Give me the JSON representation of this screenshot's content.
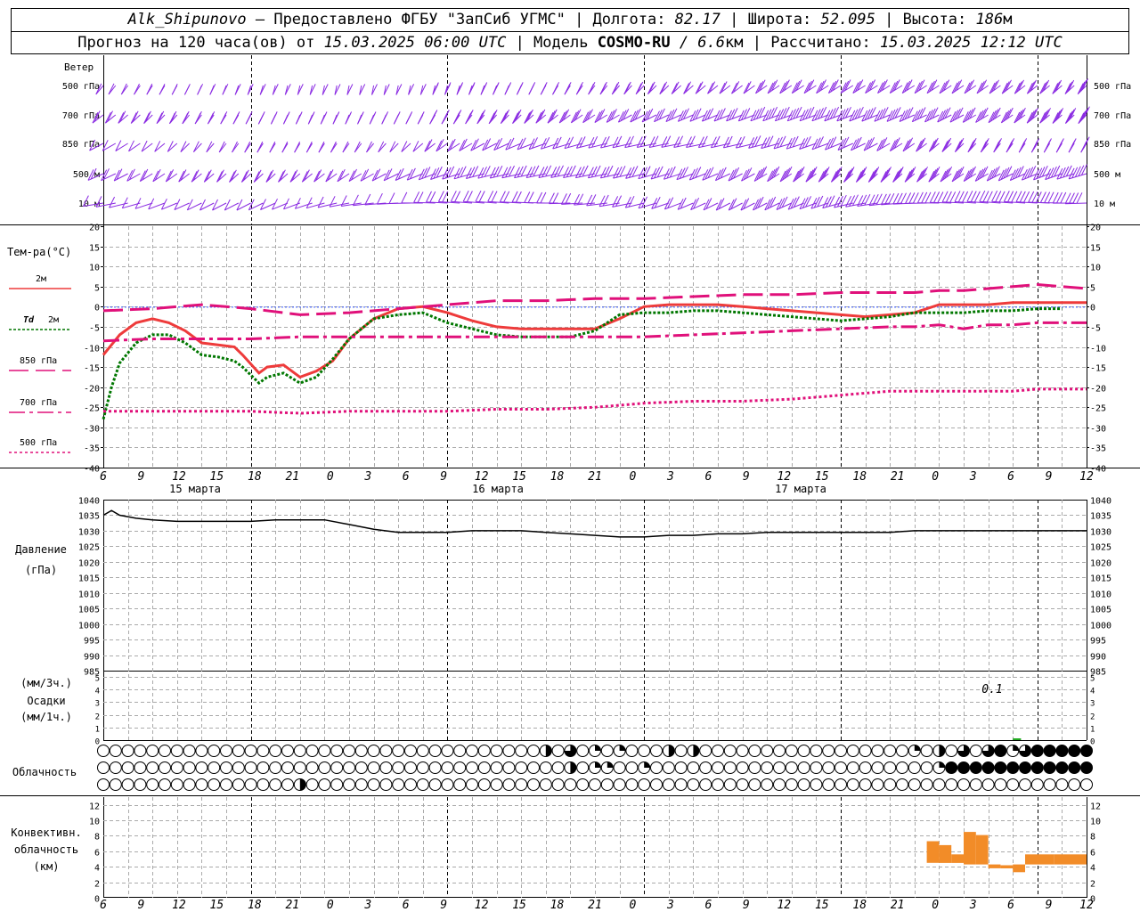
{
  "header": {
    "station": "Alk_Shipunovo",
    "provider": " – Предоставлено ФГБУ \"ЗапСиб УГМС\" | Долгота: ",
    "lon": "82.17",
    "lat_label": " | Широта: ",
    "lat": "52.095",
    "alt_label": " | Высота: ",
    "alt": "186",
    "alt_unit": "м",
    "forecast_prefix": "Прогноз на 120 часа(ов) от ",
    "forecast_time": "15.03.2025 06:00 UTC",
    "model_label": "  | Модель ",
    "model": "COSMO-RU",
    "model_res": " / 6.6",
    "model_unit": "км",
    "calc_label": " | Рассчитано: ",
    "calc_time": "15.03.2025 12:12 UTC"
  },
  "colors": {
    "grid": "#aaaaaa",
    "wind": "#8a2be2",
    "t2m": "#ee3b3b",
    "td2m": "#007700",
    "t850": "#e0107a",
    "t700": "#e0107a",
    "t500": "#e0107a",
    "pressure": "#000000",
    "convective": "#f28c28"
  },
  "labels": {
    "wind": "Ветер",
    "wind_levels": [
      "500 гПа",
      "700 гПа",
      "850 гПа",
      "500 м",
      "10 м"
    ],
    "temp": "Тем-ра(°C)",
    "legend_2m": "2м",
    "legend_td": "Td",
    "legend_td2": "2м",
    "legend_850": "850 гПа",
    "legend_700": "700 гПа",
    "legend_500": "500 гПа",
    "pressure1": "Давление",
    "pressure2": "(гПа)",
    "precip1": "(мм/3ч.)",
    "precip2": "Осадки",
    "precip3": "(мм/1ч.)",
    "cloud": "Облачность",
    "conv1": "Конвективн.",
    "conv2": "облачность",
    "conv3": "(км)",
    "precip_annotation": "0.1"
  },
  "chart_data": {
    "type": "line",
    "x_hours": [
      0,
      120
    ],
    "x_tick_labels": [
      "6",
      "9",
      "12",
      "15",
      "18",
      "21",
      "0",
      "3",
      "6",
      "9",
      "12",
      "15",
      "18",
      "21",
      "0",
      "3",
      "6",
      "9",
      "12",
      "15",
      "18",
      "21",
      "0",
      "3",
      "6",
      "9",
      "12"
    ],
    "date_labels": [
      "15 марта",
      "16 марта",
      "17 марта"
    ],
    "temperature": {
      "ylim": [
        -40,
        20
      ],
      "ticks": [
        -40,
        -35,
        -30,
        -25,
        -20,
        -15,
        -10,
        -5,
        0,
        5,
        10,
        15,
        20
      ],
      "series": [
        {
          "name": "2м",
          "key": "t2m",
          "x": [
            0,
            2,
            4,
            6,
            8,
            10,
            12,
            14,
            16,
            17,
            19,
            20,
            22,
            24,
            26,
            28,
            30,
            33,
            36,
            39,
            42,
            45,
            48,
            51,
            54,
            57,
            60,
            63,
            66,
            69,
            72,
            75,
            78,
            81,
            84,
            87,
            90,
            93,
            96,
            99,
            102,
            105,
            108,
            111,
            114,
            117,
            120
          ],
          "y": [
            -12,
            -7,
            -4,
            -3,
            -4,
            -6,
            -9,
            -9.5,
            -10,
            -12,
            -16.5,
            -15,
            -14.5,
            -17.5,
            -16,
            -13.5,
            -8,
            -3,
            -0.5,
            0,
            -1.5,
            -3.5,
            -5,
            -5.5,
            -5.5,
            -5.5,
            -5.5,
            -3,
            0,
            0.5,
            0.5,
            0.5,
            0,
            -0.5,
            -1,
            -1.5,
            -2,
            -2.5,
            -2,
            -1.5,
            0.5,
            0.5,
            0.5,
            1,
            1,
            1,
            1
          ]
        },
        {
          "name": "Td 2м",
          "key": "td2m",
          "x": [
            0,
            1,
            2,
            4,
            6,
            8,
            10,
            12,
            14,
            16,
            17,
            19,
            20,
            22,
            24,
            26,
            28,
            30,
            33,
            36,
            39,
            42,
            45,
            48,
            51,
            54,
            57,
            60,
            63,
            66,
            69,
            72,
            75,
            78,
            81,
            84,
            87,
            90,
            93,
            96,
            99,
            102,
            105,
            108,
            111,
            114,
            117,
            120
          ],
          "y": [
            -28,
            -20,
            -14,
            -9,
            -7,
            -7,
            -9,
            -12,
            -12.5,
            -13.5,
            -15,
            -19,
            -17.5,
            -16.5,
            -19,
            -17.5,
            -13,
            -8,
            -3,
            -2,
            -1.5,
            -4,
            -5.5,
            -7,
            -7.5,
            -7.5,
            -7.5,
            -6,
            -2,
            -1.5,
            -1.5,
            -1,
            -1,
            -1.5,
            -2,
            -2.5,
            -3,
            -3.5,
            -3,
            -2.5,
            -1.5,
            -1.5,
            -1.5,
            -1,
            -1,
            -0.5,
            -0.5
          ]
        },
        {
          "name": "850 гПа",
          "key": "t850",
          "x": [
            0,
            6,
            12,
            18,
            24,
            30,
            36,
            42,
            48,
            54,
            60,
            66,
            72,
            78,
            84,
            90,
            96,
            99,
            102,
            105,
            108,
            111,
            114,
            117,
            120
          ],
          "y": [
            -1,
            -0.5,
            0.5,
            -0.5,
            -2,
            -1.5,
            -0.5,
            0.5,
            1.5,
            1.5,
            2,
            2,
            2.5,
            3,
            3,
            3.5,
            3.5,
            3.5,
            4,
            4,
            4.5,
            5,
            5.5,
            5,
            4.5
          ]
        },
        {
          "name": "700 гПа",
          "key": "t700",
          "x": [
            0,
            6,
            12,
            18,
            24,
            30,
            36,
            42,
            48,
            54,
            60,
            66,
            72,
            78,
            84,
            90,
            96,
            99,
            102,
            105,
            108,
            111,
            114,
            117,
            120
          ],
          "y": [
            -8.5,
            -8,
            -8,
            -8,
            -7.5,
            -7.5,
            -7.5,
            -7.5,
            -7.5,
            -7.5,
            -7.5,
            -7.5,
            -7,
            -6.5,
            -6,
            -5.5,
            -5,
            -5,
            -4.5,
            -5.5,
            -4.5,
            -4.5,
            -4,
            -4,
            -4
          ]
        },
        {
          "name": "500 гПа",
          "key": "t500",
          "x": [
            0,
            6,
            12,
            18,
            24,
            30,
            36,
            42,
            48,
            54,
            60,
            66,
            72,
            78,
            84,
            90,
            96,
            99,
            102,
            105,
            108,
            111,
            114,
            117,
            120
          ],
          "y": [
            -26,
            -26,
            -26,
            -26,
            -26.5,
            -26,
            -26,
            -26,
            -25.5,
            -25.5,
            -25,
            -24,
            -23.5,
            -23.5,
            -23,
            -22,
            -21,
            -21,
            -21,
            -21,
            -21,
            -21,
            -20.5,
            -20.5,
            -20.5
          ]
        }
      ]
    },
    "pressure": {
      "ylim": [
        985,
        1040
      ],
      "ticks": [
        985,
        990,
        995,
        1000,
        1005,
        1010,
        1015,
        1020,
        1025,
        1030,
        1035,
        1040
      ],
      "x": [
        0,
        1,
        2,
        4,
        6,
        9,
        12,
        15,
        18,
        21,
        24,
        27,
        30,
        33,
        36,
        39,
        42,
        45,
        48,
        51,
        54,
        57,
        60,
        63,
        66,
        69,
        72,
        75,
        78,
        81,
        84,
        87,
        90,
        93,
        96,
        99,
        102,
        105,
        108,
        111,
        114,
        117,
        120
      ],
      "y": [
        1035,
        1036.5,
        1035,
        1034,
        1033.5,
        1033,
        1033,
        1033,
        1033,
        1033.5,
        1033.5,
        1033.5,
        1032,
        1030.5,
        1029.5,
        1029.5,
        1029.5,
        1030,
        1030,
        1030,
        1029.5,
        1029,
        1028.5,
        1028,
        1028,
        1028.5,
        1028.5,
        1029,
        1029,
        1029.5,
        1029.5,
        1029.5,
        1029.5,
        1029.5,
        1029.5,
        1030,
        1030,
        1030,
        1030,
        1030,
        1030,
        1030,
        1030
      ]
    },
    "precipitation": {
      "ylim": [
        0,
        5
      ],
      "ticks": [
        0,
        1,
        2,
        3,
        4,
        5
      ],
      "x": [
        111,
        112
      ],
      "y": [
        0.1,
        0.1
      ]
    },
    "cloud_cover": {
      "step_hours": 1.5,
      "rows": [
        {
          "name": "upper",
          "cells": {
            "36": 0.5,
            "38": 0.75,
            "40": 0.25,
            "42": 0.25,
            "46": 0.5,
            "48": 0.5,
            "66": 0.25,
            "68": 0.5,
            "70": 0.75,
            "72": 0.75,
            "73": 1,
            "74": 0.25,
            "75": 0.75,
            "76": 1,
            "77": 1,
            "78": 1,
            "79": 1,
            "80": 1,
            "81": 1,
            "82": 0.75
          }
        },
        {
          "name": "middle",
          "cells": {
            "38": 0.5,
            "40": 0.25,
            "41": 0.25,
            "44": 0.25,
            "68": 0.25,
            "69": 1,
            "70": 1,
            "71": 1,
            "72": 1,
            "73": 1,
            "74": 1,
            "75": 1,
            "76": 1,
            "77": 1,
            "78": 1,
            "79": 1,
            "80": 1,
            "81": 1,
            "82": 1
          }
        },
        {
          "name": "lower",
          "cells": {
            "16": 0.5
          }
        }
      ]
    },
    "convective_cloud": {
      "ylim": [
        0,
        13
      ],
      "ticks": [
        0,
        2,
        4,
        6,
        8,
        10,
        12
      ],
      "bars": [
        {
          "x0": 100.5,
          "x1": 102,
          "bottom": 4.5,
          "top": 7.3
        },
        {
          "x0": 102,
          "x1": 103.5,
          "bottom": 4.5,
          "top": 6.8
        },
        {
          "x0": 103.5,
          "x1": 105,
          "bottom": 4.5,
          "top": 5.6
        },
        {
          "x0": 105,
          "x1": 106.5,
          "bottom": 4.3,
          "top": 8.5
        },
        {
          "x0": 106.5,
          "x1": 108,
          "bottom": 4.3,
          "top": 8.1
        },
        {
          "x0": 108,
          "x1": 109.5,
          "bottom": 3.8,
          "top": 4.3
        },
        {
          "x0": 109.5,
          "x1": 111,
          "bottom": 3.8,
          "top": 4.2
        },
        {
          "x0": 111,
          "x1": 112.5,
          "bottom": 3.3,
          "top": 4.3
        },
        {
          "x0": 112.5,
          "x1": 116,
          "bottom": 4.3,
          "top": 5.6
        },
        {
          "x0": 116,
          "x1": 120,
          "bottom": 4.3,
          "top": 5.6
        }
      ]
    },
    "wind": {
      "levels": [
        "500 гПа",
        "700 гПа",
        "850 гПа",
        "500 м",
        "10 м"
      ],
      "step_hours": 1.5,
      "speed_ms": {
        "500 гПа": [
          10,
          12,
          14,
          16,
          18
        ],
        "700 гПа": [
          8,
          9,
          10,
          12,
          14
        ],
        "850 гПа": [
          6,
          8,
          9,
          10,
          12
        ],
        "500 м": [
          5,
          6,
          8,
          12,
          14
        ],
        "10 м": [
          3,
          3,
          4,
          5,
          6
        ]
      }
    }
  }
}
